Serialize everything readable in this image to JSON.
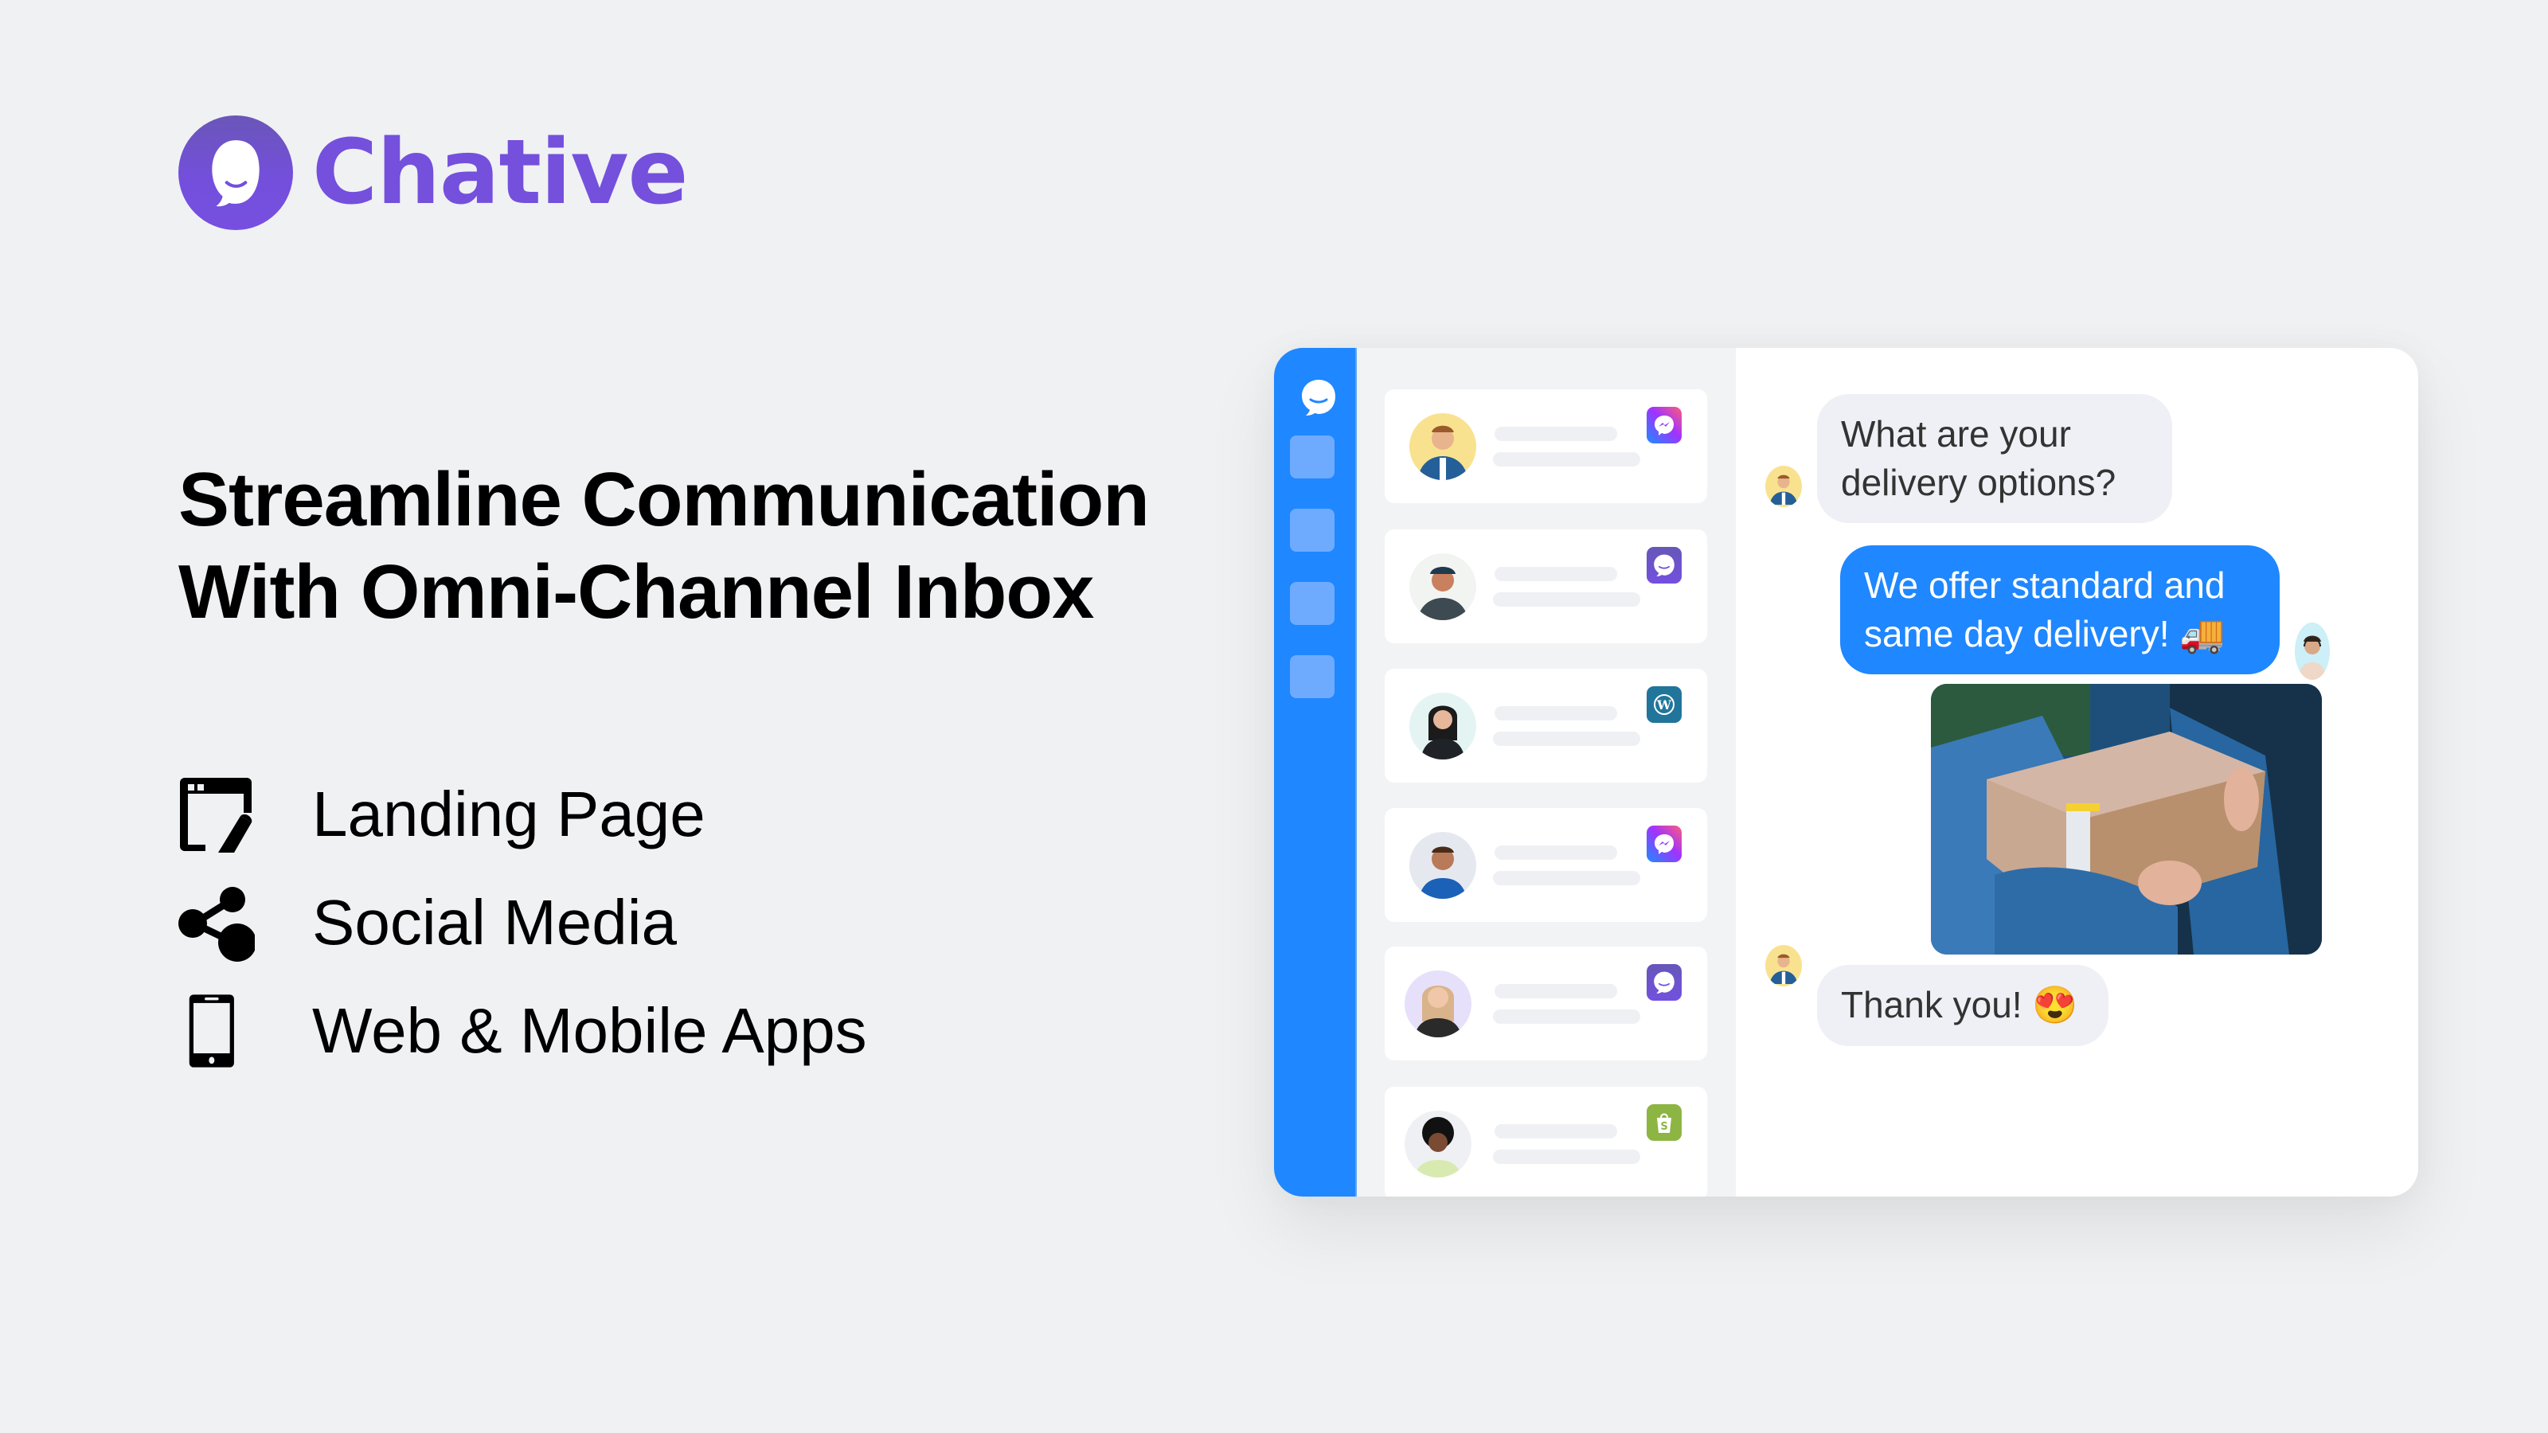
{
  "brand": {
    "name": "Chative",
    "logo_icon": "chat-bubble-smile-icon",
    "color": "#7450dd"
  },
  "headline": {
    "line1": "Streamline Communication",
    "line2": "With Omni-Channel Inbox"
  },
  "features": [
    {
      "icon": "landing-page-edit-icon",
      "label": "Landing Page"
    },
    {
      "icon": "share-icon",
      "label": "Social Media"
    },
    {
      "icon": "mobile-phone-icon",
      "label": "Web & Mobile Apps"
    }
  ],
  "mockup": {
    "accent_color": "#1f87ff",
    "sidebar": {
      "logo_icon": "chat-bubble-smile-icon",
      "items": [
        {
          "icon": "nav-item-icon"
        },
        {
          "icon": "nav-item-icon"
        },
        {
          "icon": "nav-item-icon"
        },
        {
          "icon": "nav-item-icon"
        }
      ]
    },
    "conversations": [
      {
        "avatar": "man-yellow-background",
        "channel": "messenger",
        "channel_icon": "messenger-icon"
      },
      {
        "avatar": "man-cap",
        "channel": "chative",
        "channel_icon": "chative-icon"
      },
      {
        "avatar": "woman-dark-hair",
        "channel": "wordpress",
        "channel_icon": "wordpress-icon"
      },
      {
        "avatar": "man-blue-shirt",
        "channel": "messenger",
        "channel_icon": "messenger-icon"
      },
      {
        "avatar": "woman-blonde",
        "channel": "chative",
        "channel_icon": "chative-icon"
      },
      {
        "avatar": "woman-curly-hair",
        "channel": "shopify",
        "channel_icon": "shopify-icon"
      }
    ],
    "messages": [
      {
        "direction": "incoming",
        "line1": "What are your",
        "line2": "delivery options?"
      },
      {
        "direction": "outgoing",
        "line1": "We offer standard and",
        "line2": "same day delivery! 🚚"
      },
      {
        "direction": "outgoing",
        "type": "image",
        "alt": "delivery-package-photo"
      },
      {
        "direction": "incoming",
        "text": "Thank you! 😍"
      }
    ]
  }
}
